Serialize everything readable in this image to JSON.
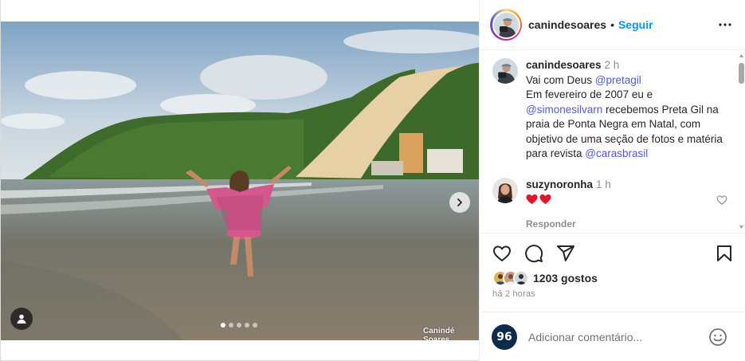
{
  "post": {
    "photo_credit": "Canindé Soares",
    "carousel_dots": 5,
    "active_dot": 0
  },
  "header": {
    "username": "canindesoares",
    "separator": "•",
    "follow_label": "Seguir"
  },
  "caption": {
    "username": "canindesoares",
    "time": "2 h",
    "line1_prefix": "Vai com Deus ",
    "mention1": "@pretagil",
    "line2": "Em fevereiro de 2007 eu e",
    "mention2": "@simonesilvarn",
    "line3": " recebemos Preta Gil na praia de Ponta Negra em Natal, com objetivo de uma seção de fotos e matéria  para revista ",
    "mention3": "@carasbrasil"
  },
  "comment": {
    "username": "suzynoronha",
    "time": "1 h",
    "content": "❤❤",
    "reply_label": "Responder"
  },
  "likes": {
    "count_label": "1203 gostos"
  },
  "posted": {
    "label": "há 2 horas"
  },
  "add_comment": {
    "badge": "96",
    "placeholder": "Adicionar comentário..."
  },
  "colors": {
    "accent": "#0095f6",
    "mention": "#00376b",
    "heart": "#ed4956",
    "muted": "#8e8e8e"
  }
}
